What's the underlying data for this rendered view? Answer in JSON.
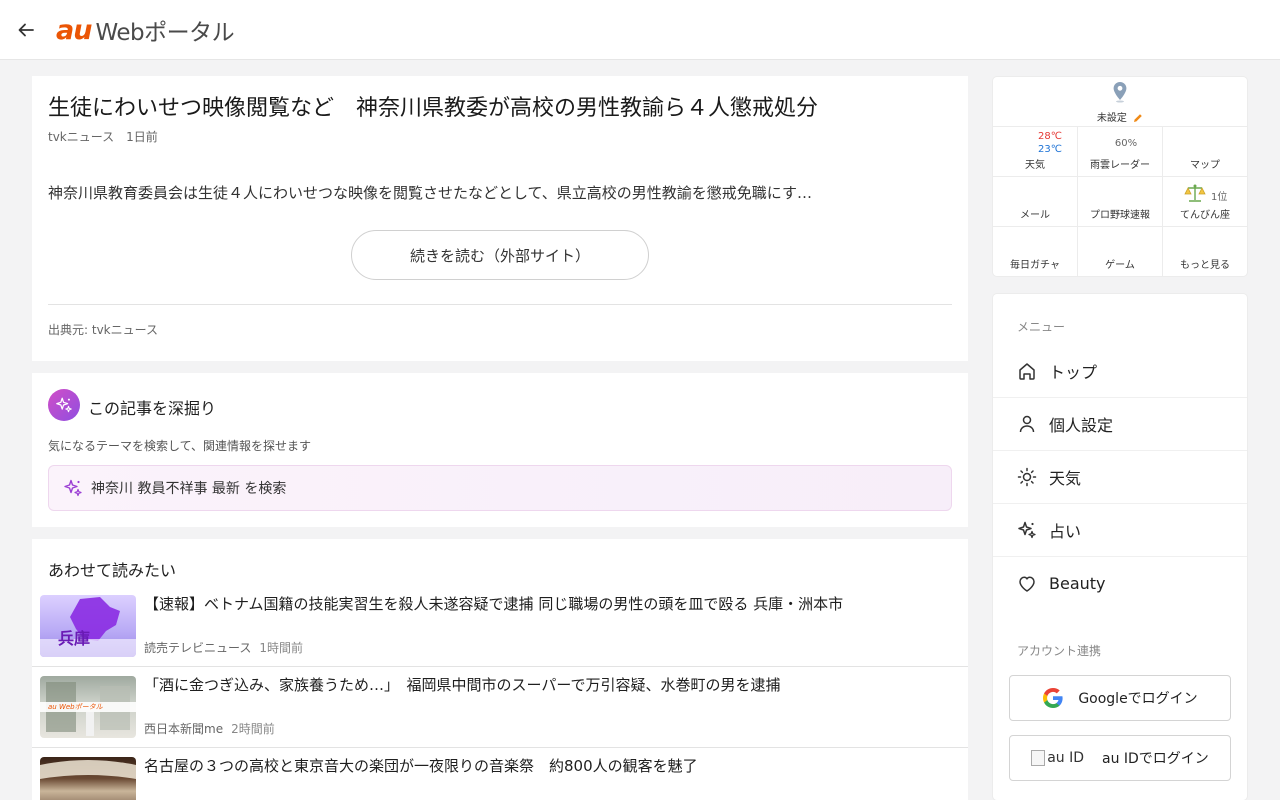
{
  "header": {
    "logo_au": "au",
    "logo_web": "Webポータル"
  },
  "article": {
    "title": "生徒にわいせつ映像閲覧など　神奈川県教委が高校の男性教諭ら４人懲戒処分",
    "source_name": "tvkニュース",
    "time_ago": "1日前",
    "summary": "神奈川県教育委員会は生徒４人にわいせつな映像を閲覧させたなどとして、県立高校の男性教諭を懲戒免職にす…",
    "read_more_label": "続きを読む（外部サイト）",
    "source_credit": "出典元: tvkニュース"
  },
  "dig": {
    "title": "この記事を深掘り",
    "hint": "気になるテーマを検索して、関連情報を探せます",
    "search_label": "神奈川 教員不祥事 最新 を検索"
  },
  "related": {
    "title": "あわせて読みたい",
    "items": [
      {
        "title": "【速報】ベトナム国籍の技能実習生を殺人未遂容疑で逮捕 同じ職場の男性の頭を皿で殴る 兵庫・洲本市",
        "source": "読売テレビニュース",
        "time": "1時間前",
        "thumb_text": "兵庫"
      },
      {
        "title": "「酒に金つぎ込み、家族養うため…」　福岡県中間市のスーパーで万引容疑、水巻町の男を逮捕",
        "source": "西日本新聞me",
        "time": "2時間前",
        "thumb_text": "au Webポータル"
      },
      {
        "title": "名古屋の３つの高校と東京音大の楽団が一夜限りの音楽祭　約800人の観客を魅了",
        "source": "",
        "time": ""
      }
    ]
  },
  "widget": {
    "location": "未設定",
    "temp_high": "28℃",
    "temp_low": "23℃",
    "rain_percent": "60%",
    "fortune_rank": "1位",
    "cells": [
      "天気",
      "雨雲レーダー",
      "マップ",
      "メール",
      "プロ野球速報",
      "てんびん座",
      "毎日ガチャ",
      "ゲーム",
      "もっと見る"
    ]
  },
  "menu": {
    "heading": "メニュー",
    "items": [
      {
        "label": "トップ",
        "icon": "home-icon"
      },
      {
        "label": "個人設定",
        "icon": "person-icon"
      },
      {
        "label": "天気",
        "icon": "sun-icon"
      },
      {
        "label": "占い",
        "icon": "sparkle-icon"
      },
      {
        "label": "Beauty",
        "icon": "heart-icon"
      }
    ],
    "account_heading": "アカウント連携",
    "google_login": "Googleでログイン",
    "auid_alt": "au ID",
    "auid_login": "au IDでログイン"
  },
  "colors": {
    "brand_orange": "#eb5505",
    "temp_high": "#e53935",
    "temp_low": "#1e73d6",
    "ai_gradient_start": "#d14dc7",
    "ai_gradient_end": "#8f4fe0"
  }
}
